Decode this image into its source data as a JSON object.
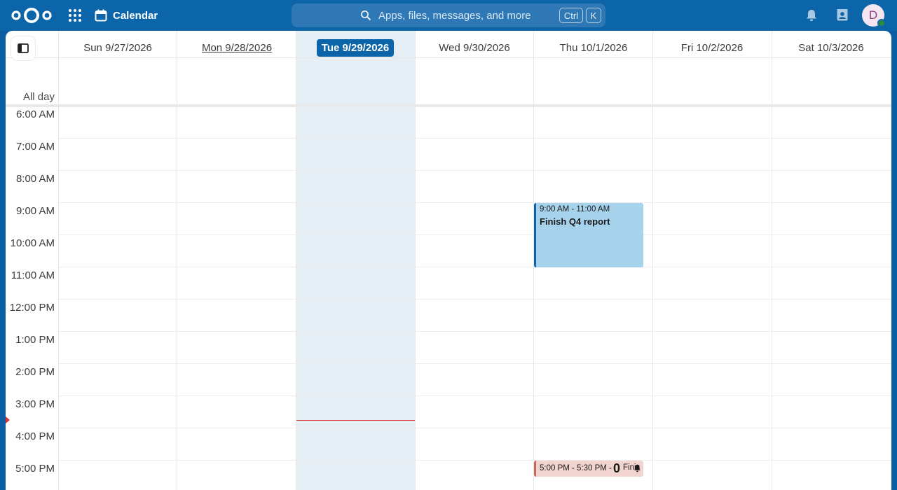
{
  "header": {
    "app_name": "Calendar",
    "search_placeholder": "Apps, files, messages, and more",
    "shortcut_ctrl": "Ctrl",
    "shortcut_key": "K",
    "user_initial": "D"
  },
  "calendar": {
    "allday_label": "All day",
    "days": [
      {
        "label": "Sun 9/27/2026",
        "state": "normal"
      },
      {
        "label": "Mon 9/28/2026",
        "state": "hovered"
      },
      {
        "label": "Tue 9/29/2026",
        "state": "today"
      },
      {
        "label": "Wed 9/30/2026",
        "state": "normal"
      },
      {
        "label": "Thu 10/1/2026",
        "state": "normal"
      },
      {
        "label": "Fri 10/2/2026",
        "state": "normal"
      },
      {
        "label": "Sat 10/3/2026",
        "state": "normal"
      }
    ],
    "hours": [
      "6:00 AM",
      "7:00 AM",
      "8:00 AM",
      "9:00 AM",
      "10:00 AM",
      "11:00 AM",
      "12:00 PM",
      "1:00 PM",
      "2:00 PM",
      "3:00 PM",
      "4:00 PM",
      "5:00 PM"
    ],
    "events": [
      {
        "time": "9:00 AM - 11:00 AM",
        "title": "Finish Q4 report"
      },
      {
        "time": "5:00 PM - 5:30 PM -",
        "count": "0",
        "title_fragment": "Finis"
      }
    ]
  },
  "colors": {
    "brand": "#0b65a8",
    "today_column": "#e5edf5",
    "event_blue": "#a7d2ec",
    "event_pink": "#f1d3d0",
    "now_indicator": "#dd3333"
  }
}
